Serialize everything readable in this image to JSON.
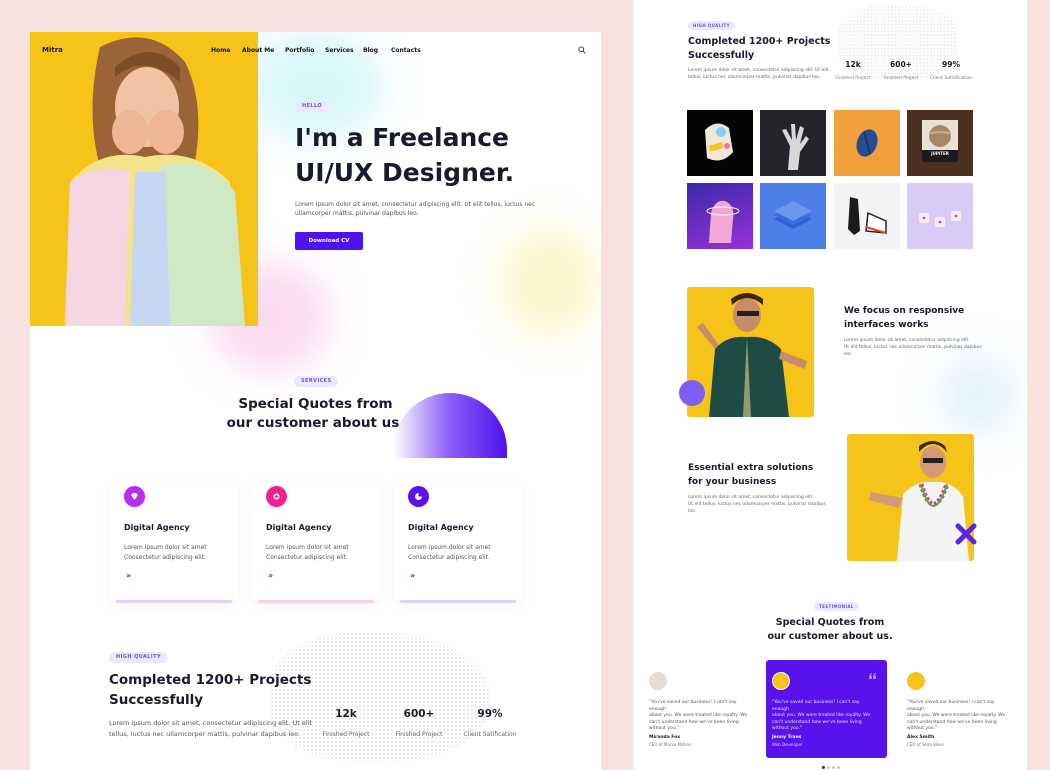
{
  "brand": "Mitra",
  "nav": [
    "Home",
    "About Me",
    "Portfolio",
    "Services",
    "Blog",
    "Contacts"
  ],
  "hero": {
    "tag": "HELLO",
    "title_line1": "I'm a Freelance",
    "title_line2": "UI/UX Designer.",
    "desc_line1": "Lorem ipsum dolor sit amet, consectetur adipiscing elit. Ut elit tellus, luctus nec",
    "desc_line2": "ullamcorper mattis, pulvinar dapibus leo.",
    "button": "Download CV"
  },
  "services": {
    "tag": "SERVICES",
    "title_line1": "Special Quotes from",
    "title_line2": "our customer about us.",
    "cards": [
      {
        "title": "Digital Agency",
        "line1": "Lorem ipsum dolor sit amet",
        "line2": "Consectetur adipiscing elit.",
        "arrow": "»",
        "color": "#b92cf0"
      },
      {
        "title": "Digital Agency",
        "line1": "Lorem ipsum dolor sit amet",
        "line2": "Consectetur adipiscing elit.",
        "arrow": "»",
        "color": "#f0208f"
      },
      {
        "title": "Digital Agency",
        "line1": "Lorem ipsum dolor sit amet",
        "line2": "Consectetur adipiscing elit.",
        "arrow": "»",
        "color": "#5a12e8"
      }
    ]
  },
  "quality": {
    "tag": "HIGH QUALITY",
    "title_line1": "Completed 1200+ Projects",
    "title_line2": "Successfully",
    "desc_line1": "Lorem ipsum dolor sit amet, consectetur adipiscing elit. Ut elit",
    "desc_line2": "tellus, luctus nec ullamcorper mattis, pulvinar dapibus leo.",
    "stats": [
      {
        "value": "12k",
        "label": "Finished Project"
      },
      {
        "value": "600+",
        "label": "Finished Project"
      },
      {
        "value": "99%",
        "label": "Client Satification"
      }
    ]
  },
  "right": {
    "quality_tag": "HIGH QUALITY",
    "quality_title_line1": "Completed 1200+ Projects",
    "quality_title_line2": "Successfully",
    "quality_desc_line1": "Lorem ipsum dolor sit amet, consectetur adipiscing elit. Ut elit",
    "quality_desc_line2": "tellus, luctus nec ullamcorper mattis, pulvinar dapibus leo.",
    "stats": [
      {
        "value": "12k",
        "label": "Finished Project"
      },
      {
        "value": "600+",
        "label": "Finished Project"
      },
      {
        "value": "99%",
        "label": "Client Satisfication"
      }
    ],
    "tile_label": "JUPITER",
    "feature1": {
      "title_line1": "We focus on responsive",
      "title_line2": "interfaces works",
      "desc_line1": "Lorem ipsum dolor sit amet, consectetur adipiscing elit.",
      "desc_line2": "Ut elit tellus, luctus nec ullamcorper mattis, pulvinar dapibus",
      "desc_line3": "leo."
    },
    "feature2": {
      "title_line1": "Essential extra solutions",
      "title_line2": "for your business",
      "desc_line1": "Lorem ipsum dolor sit amet, consectetur adipiscing elit.",
      "desc_line2": "Ut elit tellus, luctus nec ullamcorper mattis, pulvinar dapibus",
      "desc_line3": "leo."
    },
    "testimonial_tag": "TESTIMONIAL",
    "testimonial_title_line1": "Special Quotes from",
    "testimonial_title_line2": "our customer about us.",
    "testimonials": [
      {
        "quote_line1": "\"You've saved our business! I can't say enough",
        "quote_line2": "about you. We were treated like royalty. We",
        "quote_line3": "can't understand how we've been living",
        "quote_line4": "without you.\"",
        "name": "Miranda Fox",
        "role": "CEO of Marvo Motion"
      },
      {
        "quote_line1": "\"You've saved our business! I can't say enough",
        "quote_line2": "about you. We were treated like royalty. We",
        "quote_line3": "can't understand how we've been living",
        "quote_line4": "without you.\"",
        "name": "Jenny Trans",
        "role": "Web Developer"
      },
      {
        "quote_line1": "\"You've saved our business! I can't say enough",
        "quote_line2": "about you. We were treated like royalty. We",
        "quote_line3": "can't understand how we've been living",
        "quote_line4": "without you.\"",
        "name": "Alex Smith",
        "role": "CEO of Seda Bikes"
      }
    ]
  },
  "colors": {
    "accent": "#4d13ec",
    "hero_yellow": "#f6c319",
    "page_bg": "#f8e2df"
  }
}
